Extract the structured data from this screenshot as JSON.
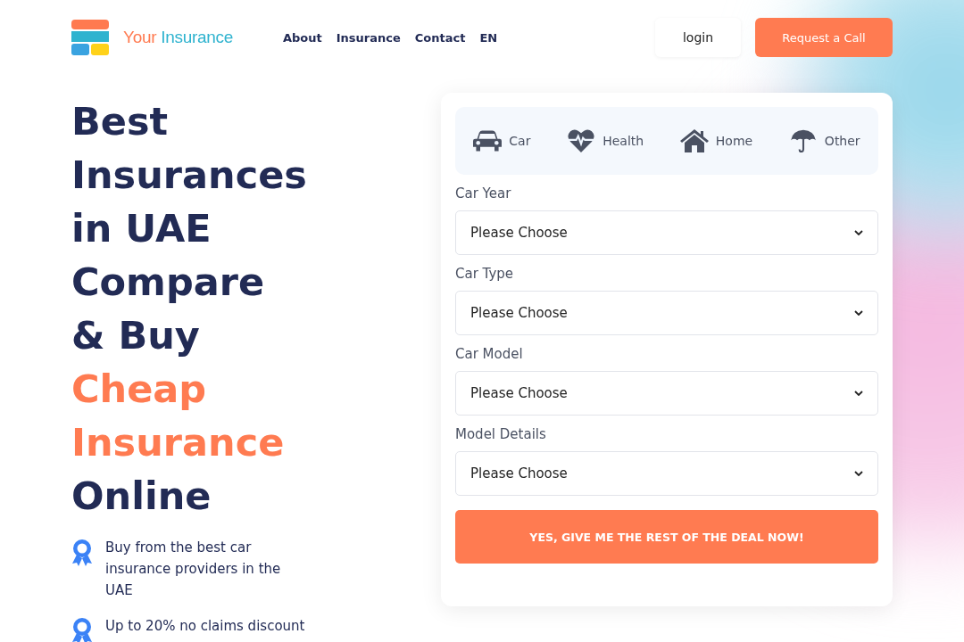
{
  "brand": {
    "part_1": "Your",
    "part_2": "Insurance"
  },
  "nav": [
    {
      "label": "About"
    },
    {
      "label": "Insurance"
    },
    {
      "label": "Contact"
    },
    {
      "label": "EN"
    }
  ],
  "login_button": "login",
  "call_button": "Request a Call",
  "headline": {
    "lead": "Best Insurances in UAE Compare & Buy",
    "highlight": "Cheap Insurance",
    "tail": "Online"
  },
  "features": [
    "Buy from the best car insurance providers in the UAE",
    "Up to 20% no claims discount"
  ],
  "tabs": [
    {
      "kind": "car",
      "label": "Car"
    },
    {
      "kind": "health",
      "label": "Health"
    },
    {
      "kind": "home",
      "label": "Home"
    },
    {
      "kind": "other",
      "label": "Other"
    }
  ],
  "fields": [
    {
      "label": "Car Year",
      "value": "Please Choose"
    },
    {
      "label": "Car Type",
      "value": "Please Choose"
    },
    {
      "label": "Car Model",
      "value": "Please Choose"
    },
    {
      "label": "Model Details",
      "value": "Please Choose"
    }
  ],
  "submit_button": "YES, GIVE ME THE REST OF THE DEAL NOW!"
}
